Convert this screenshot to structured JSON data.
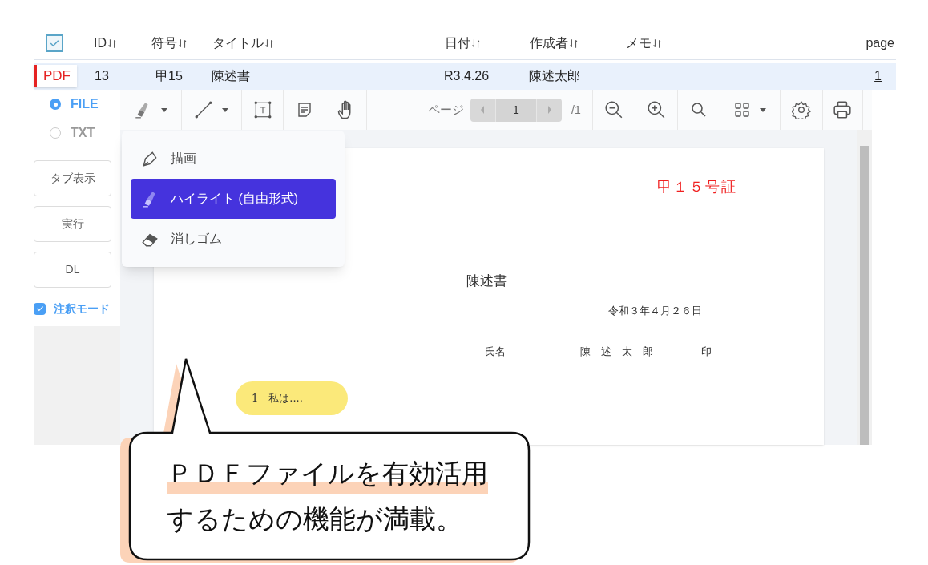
{
  "table": {
    "header_checkbox": {
      "checked": true
    },
    "columns": [
      {
        "label": "ID",
        "sortable": true
      },
      {
        "label": "符号",
        "sortable": true
      },
      {
        "label": "タイトル",
        "sortable": true
      },
      {
        "label": "日付",
        "sortable": true
      },
      {
        "label": "作成者",
        "sortable": true
      },
      {
        "label": "メモ",
        "sortable": true
      },
      {
        "label": "page",
        "sortable": false
      }
    ],
    "rows": [
      {
        "type_badge": "PDF",
        "id": "13",
        "symbol": "甲15",
        "title": "陳述書",
        "date": "R3.4.26",
        "author": "陳述太郎",
        "page": "1",
        "selected": true
      }
    ]
  },
  "sidebar": {
    "source_options": [
      {
        "label": "FILE",
        "selected": true
      },
      {
        "label": "TXT",
        "selected": false
      }
    ],
    "buttons": [
      "タブ表示",
      "実行",
      "DL"
    ],
    "annotation_mode": {
      "label": "注釈モード",
      "checked": true
    }
  },
  "toolbar": {
    "page_label": "ページ",
    "page_value": "1",
    "page_total": "/1"
  },
  "annotation_menu": {
    "items": [
      {
        "label": "描画",
        "kind": "pen",
        "selected": false
      },
      {
        "label": "ハイライト (自由形式)",
        "kind": "highlighter",
        "selected": true
      },
      {
        "label": "消しゴム",
        "kind": "eraser",
        "selected": false
      }
    ]
  },
  "document": {
    "exhibit_mark": "甲１５号証",
    "title": "陳述書",
    "date": "令和３年４月２６日",
    "name_label": "氏名",
    "name": "陳　述　太　郎",
    "seal": "印",
    "highlight_note": "1　私は...."
  },
  "callout": {
    "lines": [
      "ＰＤＦファイルを有効活用",
      "するための機能が満載。"
    ]
  }
}
